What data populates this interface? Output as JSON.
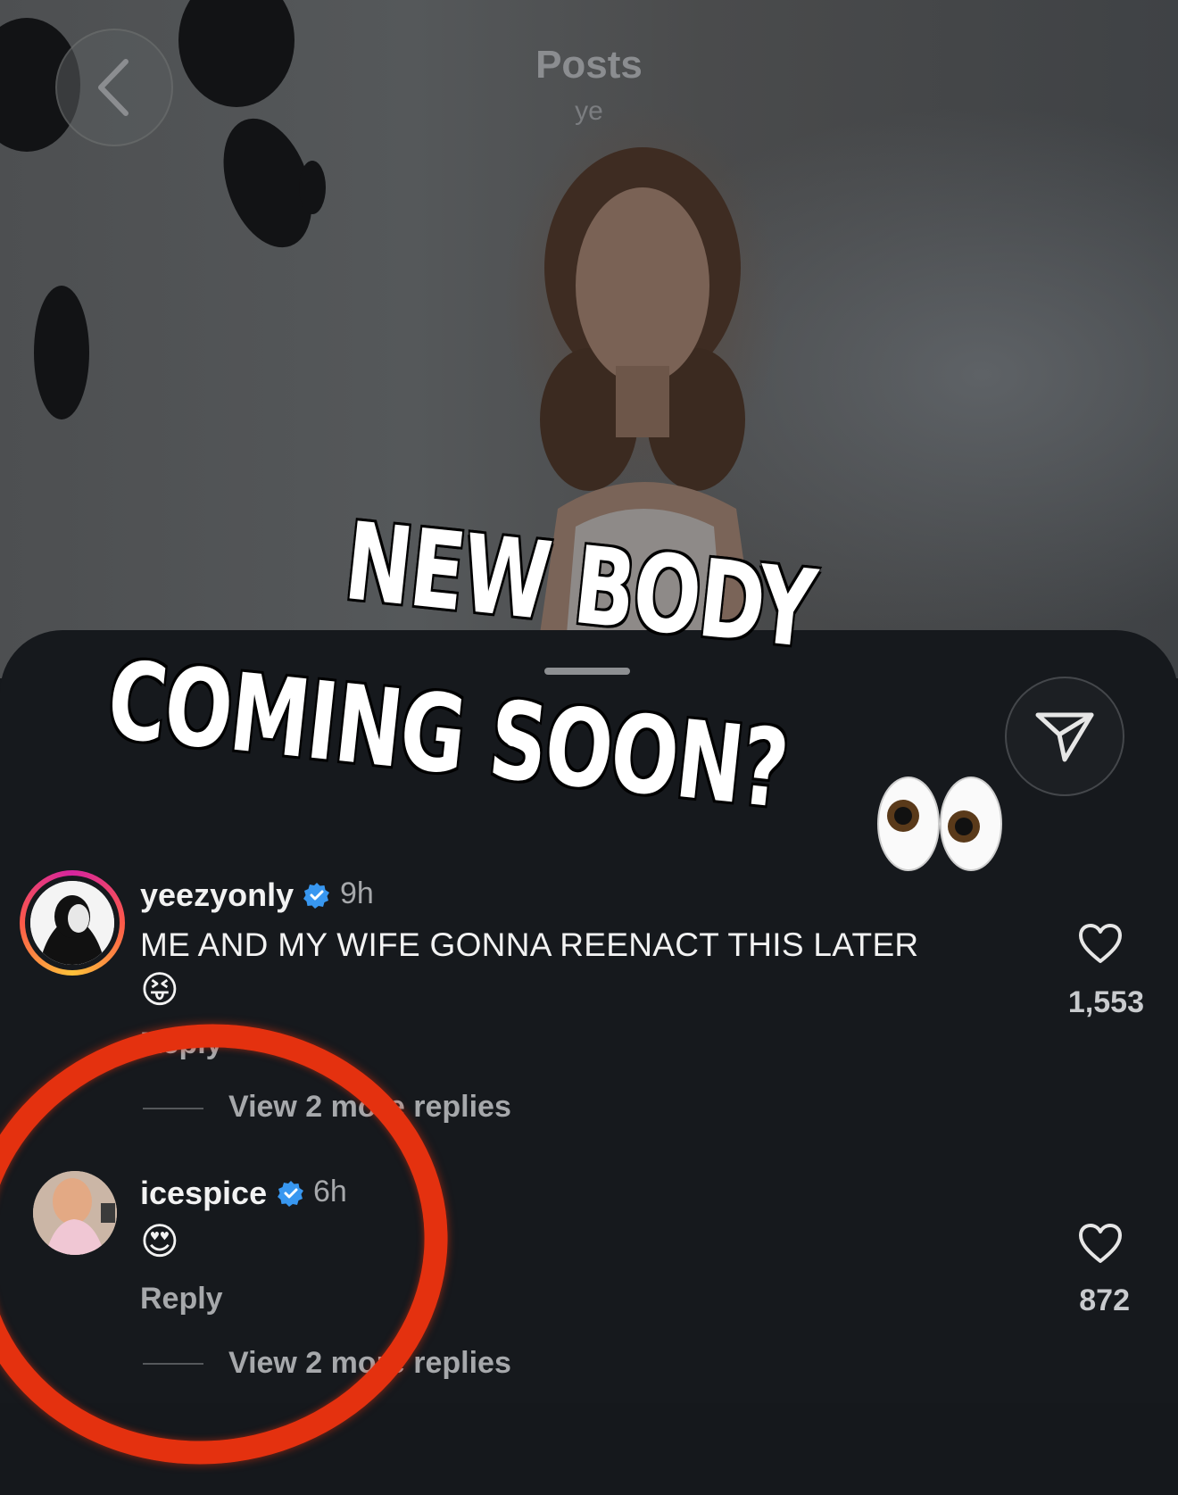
{
  "header": {
    "title": "Posts",
    "subtitle": "ye"
  },
  "post": {
    "overlay_line1": "NEW BODY",
    "overlay_line2": "COMING SOON?",
    "overlay_emoji": "👀"
  },
  "comments": [
    {
      "username": "yeezyonly",
      "verified": true,
      "time": "9h",
      "text": "ME AND MY WIFE GONNA REENACT THIS LATER",
      "emoji": "😝",
      "reply_label": "Reply",
      "likes": "1,553",
      "view_replies": "View 2 more replies"
    },
    {
      "username": "icespice",
      "verified": true,
      "time": "6h",
      "text": "😍",
      "reply_label": "Reply",
      "likes": "872",
      "view_replies": "View 2 more replies"
    }
  ],
  "icons": {
    "back": "chevron-left-icon",
    "share": "send-icon",
    "like": "heart-icon",
    "verified": "verified-badge-icon"
  },
  "colors": {
    "verified_blue": "#3897f0",
    "story_ring": "#d6249f",
    "annotation_red": "#e4310f"
  }
}
